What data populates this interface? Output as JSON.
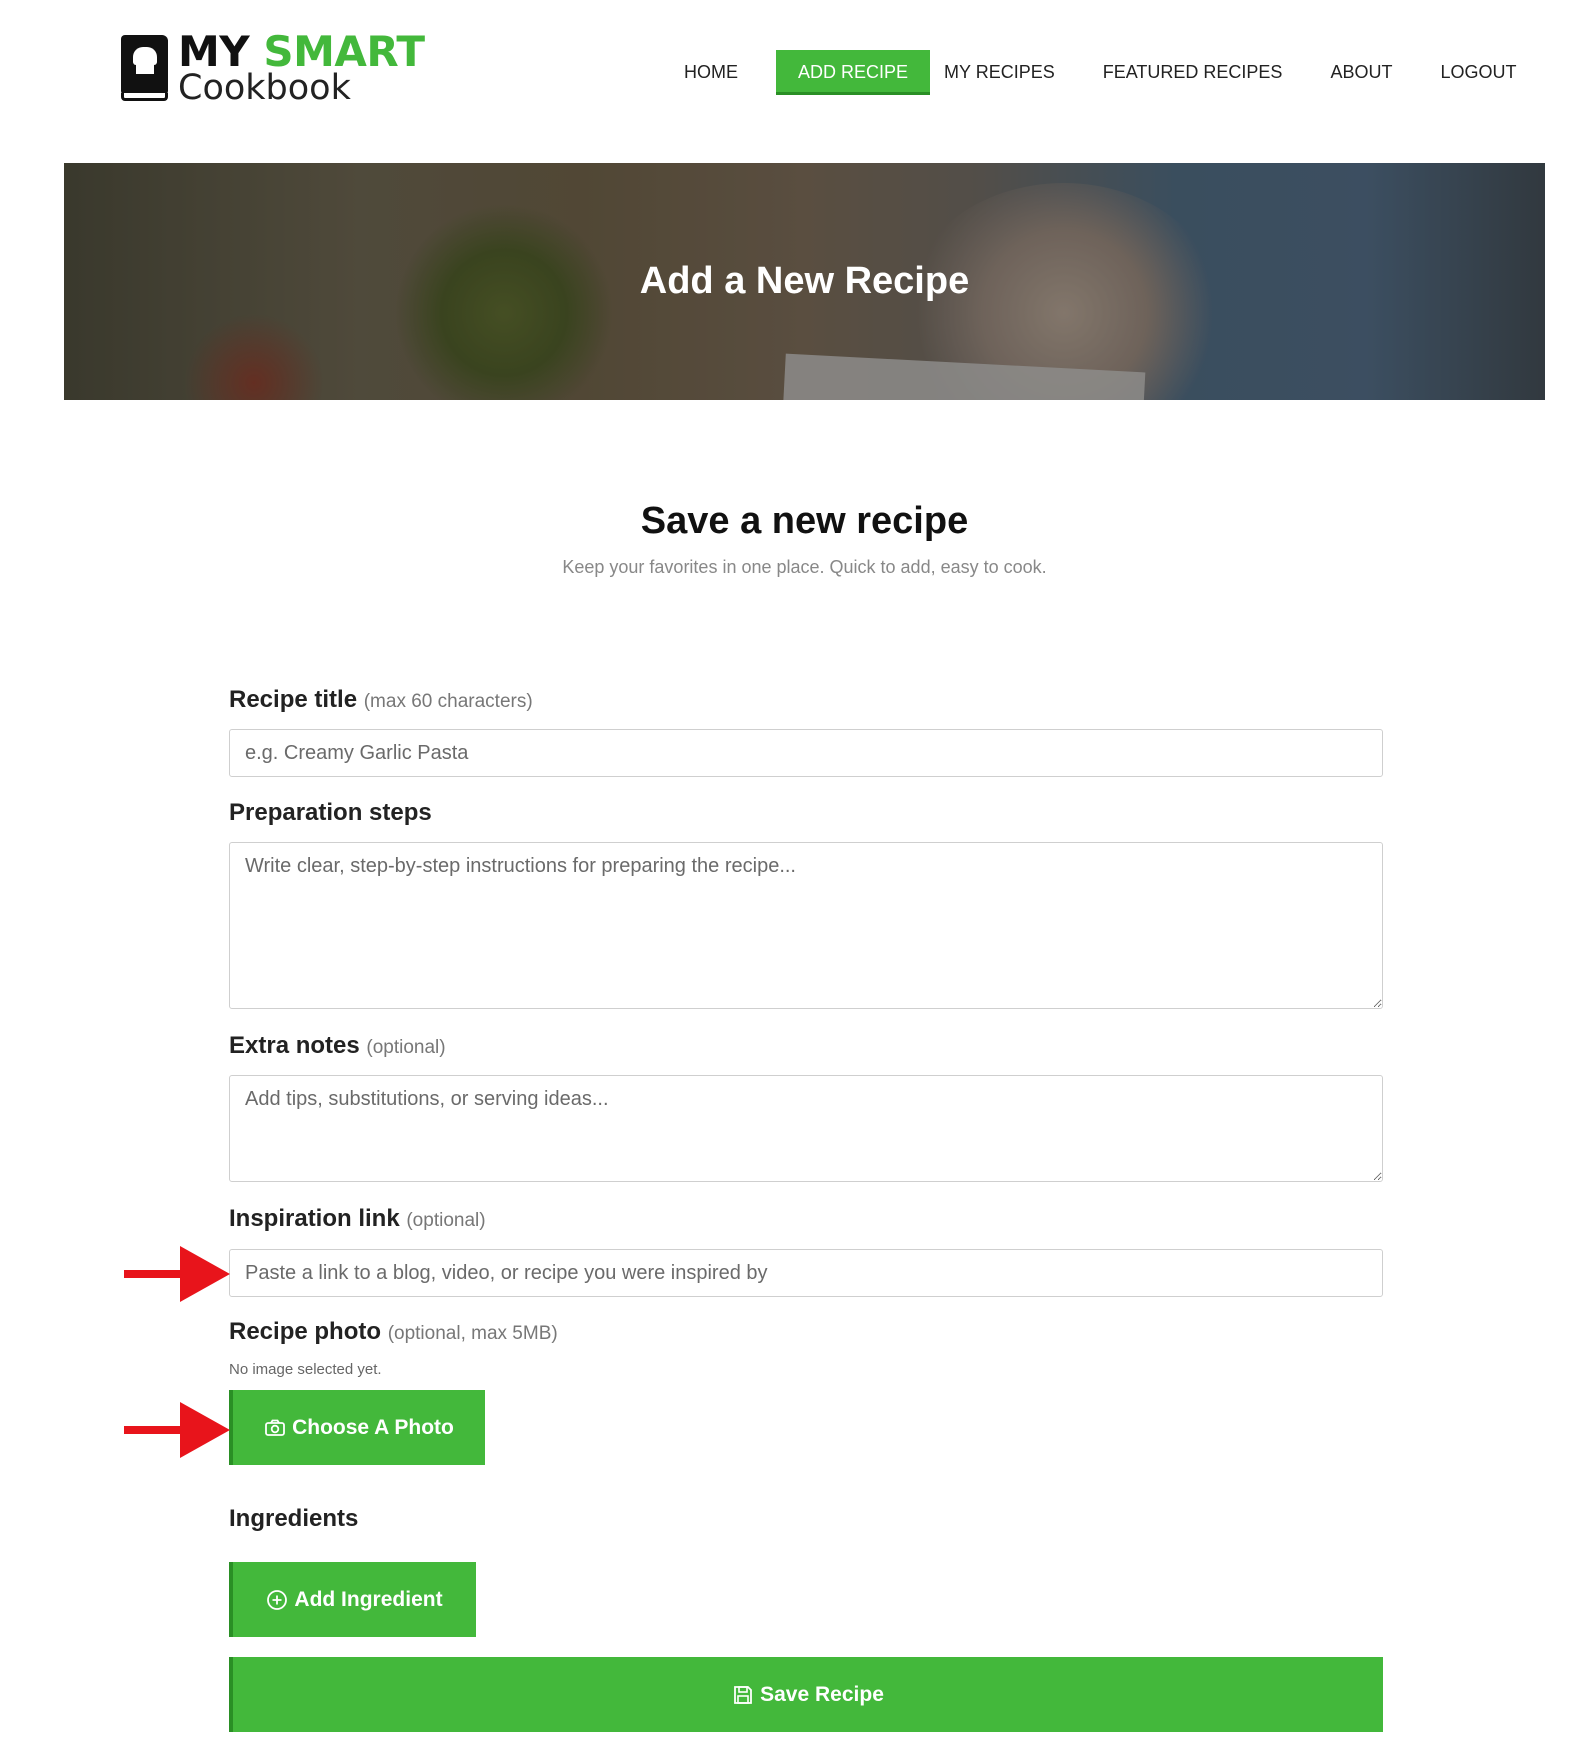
{
  "brand": {
    "line1_a": "MY",
    "line1_b": "SMART",
    "line2": "Cookbook",
    "accent": "#43b83b"
  },
  "nav": {
    "items": [
      {
        "label": "HOME",
        "active": false
      },
      {
        "label": "ADD RECIPE",
        "active": true
      },
      {
        "label": "MY RECIPES",
        "active": false
      },
      {
        "label": "FEATURED RECIPES",
        "active": false
      },
      {
        "label": "ABOUT",
        "active": false
      },
      {
        "label": "LOGOUT",
        "active": false
      }
    ]
  },
  "banner": {
    "title": "Add a New Recipe"
  },
  "section": {
    "title": "Save a new recipe",
    "subtitle": "Keep your favorites in one place. Quick to add, easy to cook."
  },
  "form": {
    "title": {
      "label": "Recipe title",
      "hint": "(max 60 characters)",
      "placeholder": "e.g. Creamy Garlic Pasta",
      "value": ""
    },
    "steps": {
      "label": "Preparation steps",
      "placeholder": "Write clear, step-by-step instructions for preparing the recipe...",
      "value": ""
    },
    "notes": {
      "label": "Extra notes",
      "hint": "(optional)",
      "placeholder": "Add tips, substitutions, or serving ideas...",
      "value": ""
    },
    "link": {
      "label": "Inspiration link",
      "hint": "(optional)",
      "placeholder": "Paste a link to a blog, video, or recipe you were inspired by",
      "value": ""
    },
    "photo": {
      "label": "Recipe photo",
      "hint": "(optional, max 5MB)",
      "status": "No image selected yet.",
      "button": "Choose A Photo",
      "icon": "camera-icon"
    },
    "ingredients": {
      "label": "Ingredients",
      "button": "Add Ingredient",
      "icon": "plus-circle-icon"
    },
    "save": {
      "button": "Save Recipe",
      "icon": "floppy-disk-icon"
    }
  },
  "annotations": {
    "arrow_color": "#e8141b",
    "arrows": [
      "arrow-right-icon",
      "arrow-right-icon"
    ]
  }
}
